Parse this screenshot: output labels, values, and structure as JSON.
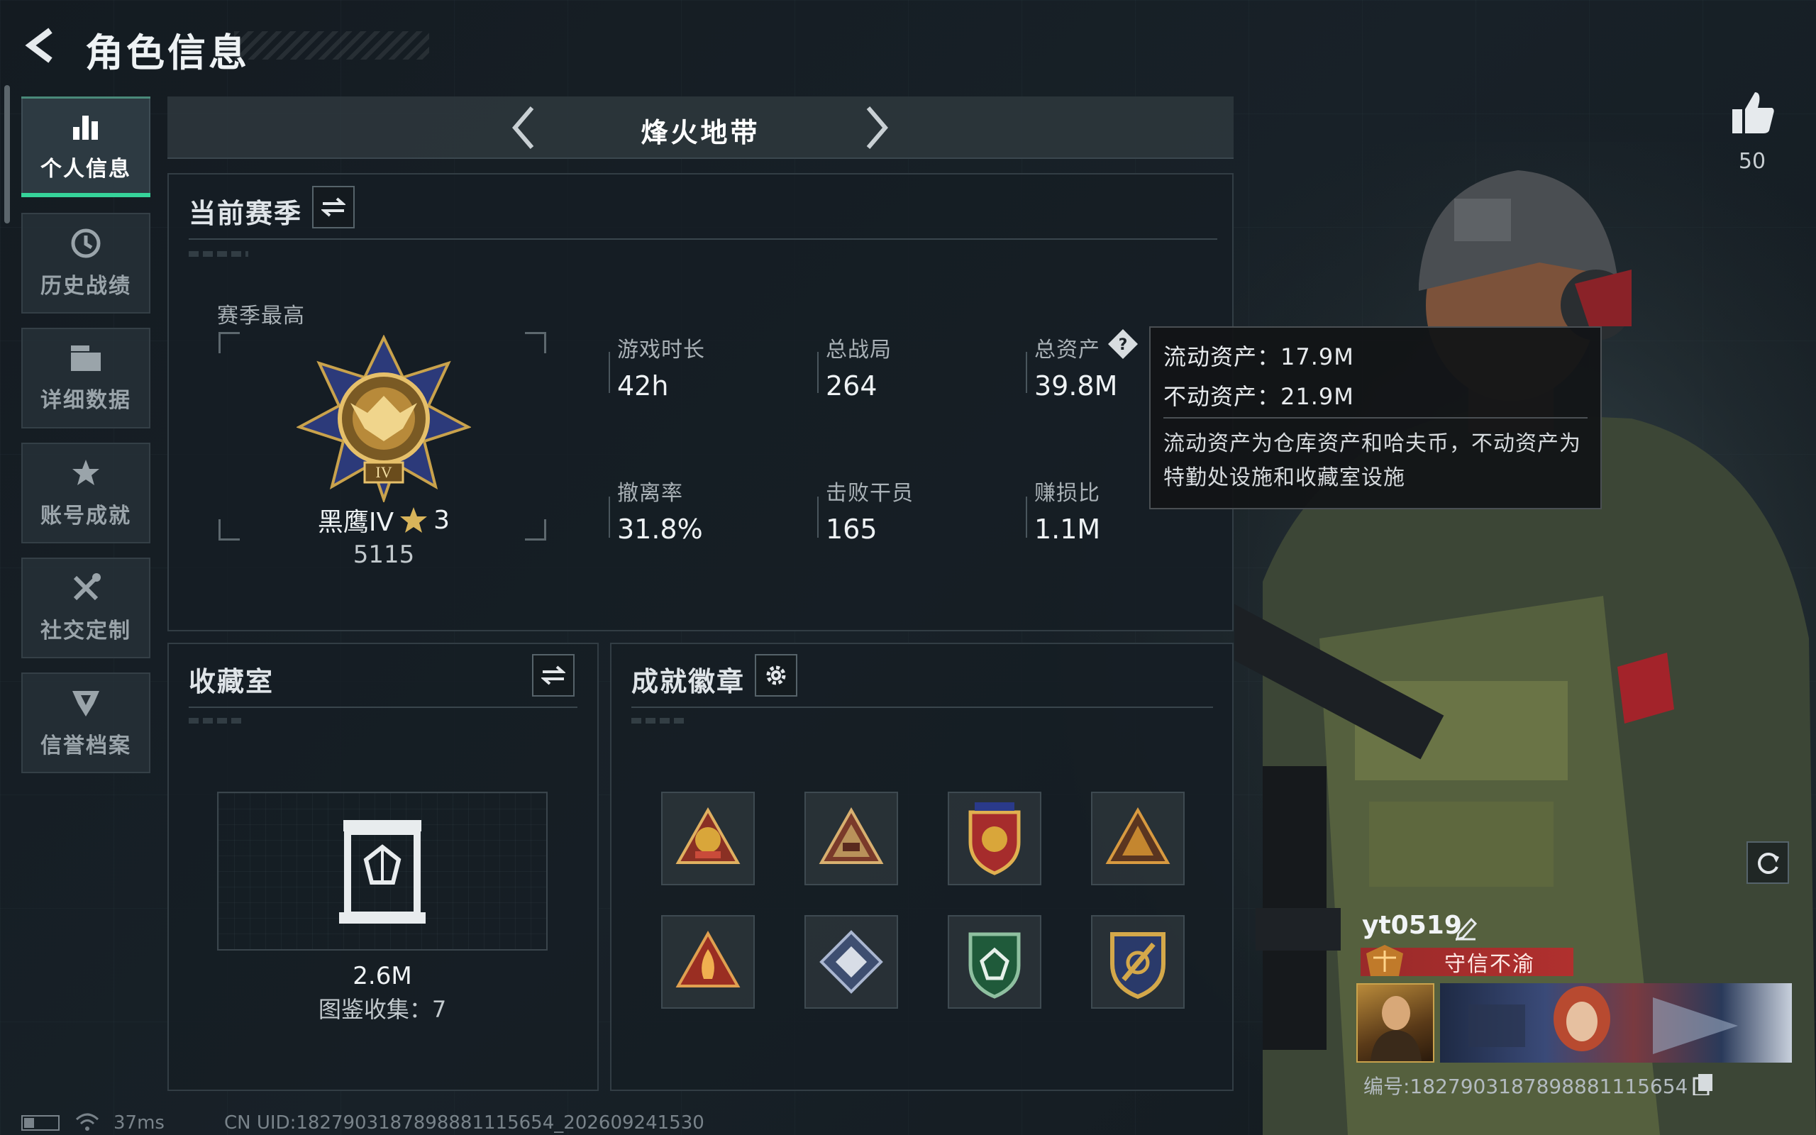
{
  "header": {
    "title": "角色信息"
  },
  "sidebar": {
    "items": [
      {
        "label": "个人信息",
        "icon": "bar-chart-icon",
        "active": true
      },
      {
        "label": "历史战绩",
        "icon": "history-clock-icon",
        "active": false
      },
      {
        "label": "详细数据",
        "icon": "folder-stack-icon",
        "active": false
      },
      {
        "label": "账号成就",
        "icon": "achievement-star-icon",
        "active": false
      },
      {
        "label": "社交定制",
        "icon": "tools-wrench-icon",
        "active": false
      },
      {
        "label": "信誉档案",
        "icon": "shield-emblem-icon",
        "active": false
      }
    ]
  },
  "mode_selector": {
    "current": "烽火地带"
  },
  "season": {
    "title": "当前赛季",
    "best_label": "赛季最高",
    "rank_name": "黑鹰IV",
    "rank_stars": "3",
    "rank_points": "5115",
    "stats": [
      {
        "label": "游戏时长",
        "value": "42h"
      },
      {
        "label": "总战局",
        "value": "264"
      },
      {
        "label": "总资产",
        "value": "39.8M"
      },
      {
        "label": "撤离率",
        "value": "31.8%"
      },
      {
        "label": "击败干员",
        "value": "165"
      },
      {
        "label": "赚损比",
        "value": "1.1M"
      }
    ]
  },
  "tooltip": {
    "liquid": "流动资产：17.9M",
    "fixed": "不动资产：21.9M",
    "description": "流动资产为仓库资产和哈夫币，不动资产为特勤处设施和收藏室设施"
  },
  "collection": {
    "title": "收藏室",
    "value": "2.6M",
    "catalog": "图鉴收集：7"
  },
  "badges": {
    "title": "成就徽章",
    "items": [
      {
        "icon": "shooting-badge-icon",
        "color": "#c94b3a"
      },
      {
        "icon": "elite-triangle-badge-icon",
        "color": "#b9925a"
      },
      {
        "icon": "eagle-shield-badge-icon",
        "color": "#d9a63a"
      },
      {
        "icon": "squad-triangle-badge-icon",
        "color": "#c4862f"
      },
      {
        "icon": "flame-triangle-badge-icon",
        "color": "#c6462e"
      },
      {
        "icon": "armor-diamond-badge-icon",
        "color": "#7d8fb3"
      },
      {
        "icon": "gem-shield-badge-icon",
        "color": "#3a8f5a"
      },
      {
        "icon": "sword-crest-badge-icon",
        "color": "#d4a84a"
      }
    ]
  },
  "profile": {
    "likes": "50",
    "name": "yt0519",
    "reputation": "守信不渝",
    "uid": "编号:1827903187898881115654"
  },
  "footer": {
    "latency": "37ms",
    "uid_line": "CN UID:1827903187898881115654_202609241530"
  },
  "colors": {
    "accent_green": "#36d39a",
    "reputation_red": "#b0302e",
    "gold": "#d9a63a"
  }
}
